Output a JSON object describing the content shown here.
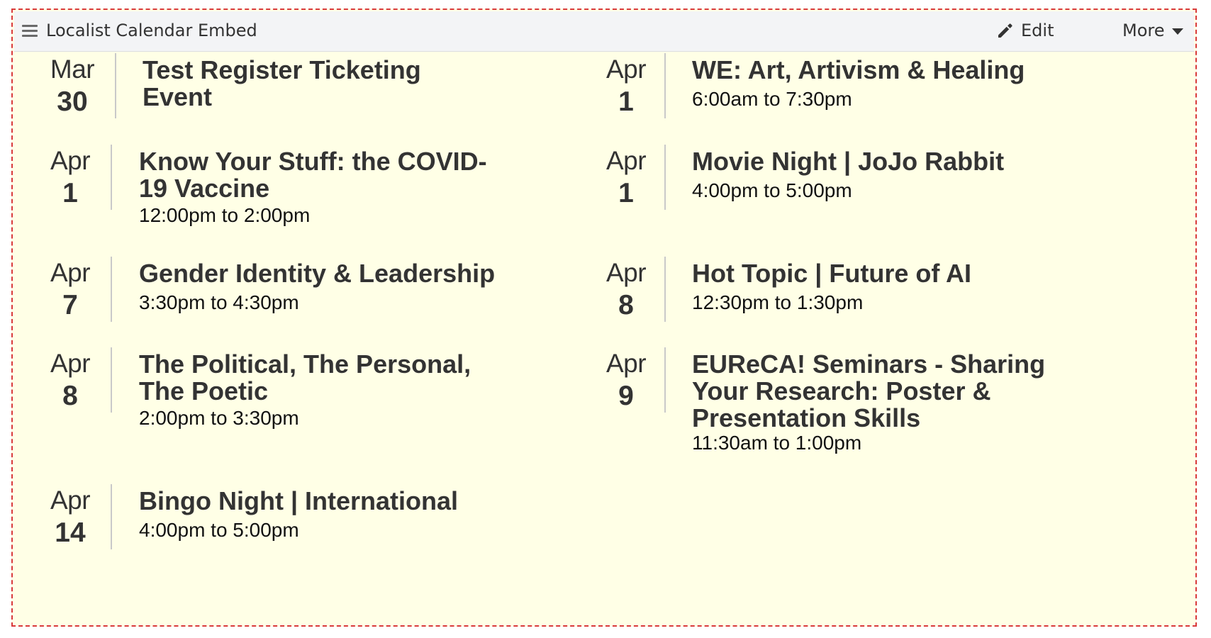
{
  "header": {
    "title": "Localist Calendar Embed",
    "edit_label": "Edit",
    "more_label": "More"
  },
  "icons": {
    "drag": "hamburger-drag-icon",
    "edit": "pencil-icon",
    "more": "caret-down-icon"
  },
  "colors": {
    "block_background": "#ffffe6",
    "header_background": "#f3f4f6",
    "dashed_border": "#d93a3a",
    "text": "#333333"
  },
  "events": [
    {
      "month": "Mar",
      "day": "30",
      "title": "Test Register Ticketing Event",
      "time": ""
    },
    {
      "month": "Apr",
      "day": "1",
      "title": "WE: Art, Artivism & Healing",
      "time": "6:00am to 7:30pm"
    },
    {
      "month": "Apr",
      "day": "1",
      "title": "Know Your Stuff: the COVID-19 Vaccine",
      "time": "12:00pm to 2:00pm"
    },
    {
      "month": "Apr",
      "day": "1",
      "title": "Movie Night | JoJo Rabbit",
      "time": "4:00pm to 5:00pm"
    },
    {
      "month": "Apr",
      "day": "7",
      "title": "Gender Identity & Leadership",
      "time": "3:30pm to 4:30pm"
    },
    {
      "month": "Apr",
      "day": "8",
      "title": "Hot Topic | Future of AI",
      "time": "12:30pm to 1:30pm"
    },
    {
      "month": "Apr",
      "day": "8",
      "title": "The Political, The Personal, The Poetic",
      "time": "2:00pm to 3:30pm"
    },
    {
      "month": "Apr",
      "day": "9",
      "title": "EUReCA! Seminars - Sharing Your Research: Poster & Presentation Skills",
      "time": "11:30am to 1:00pm"
    },
    {
      "month": "Apr",
      "day": "14",
      "title": "Bingo Night | International",
      "time": "4:00pm to 5:00pm"
    }
  ]
}
